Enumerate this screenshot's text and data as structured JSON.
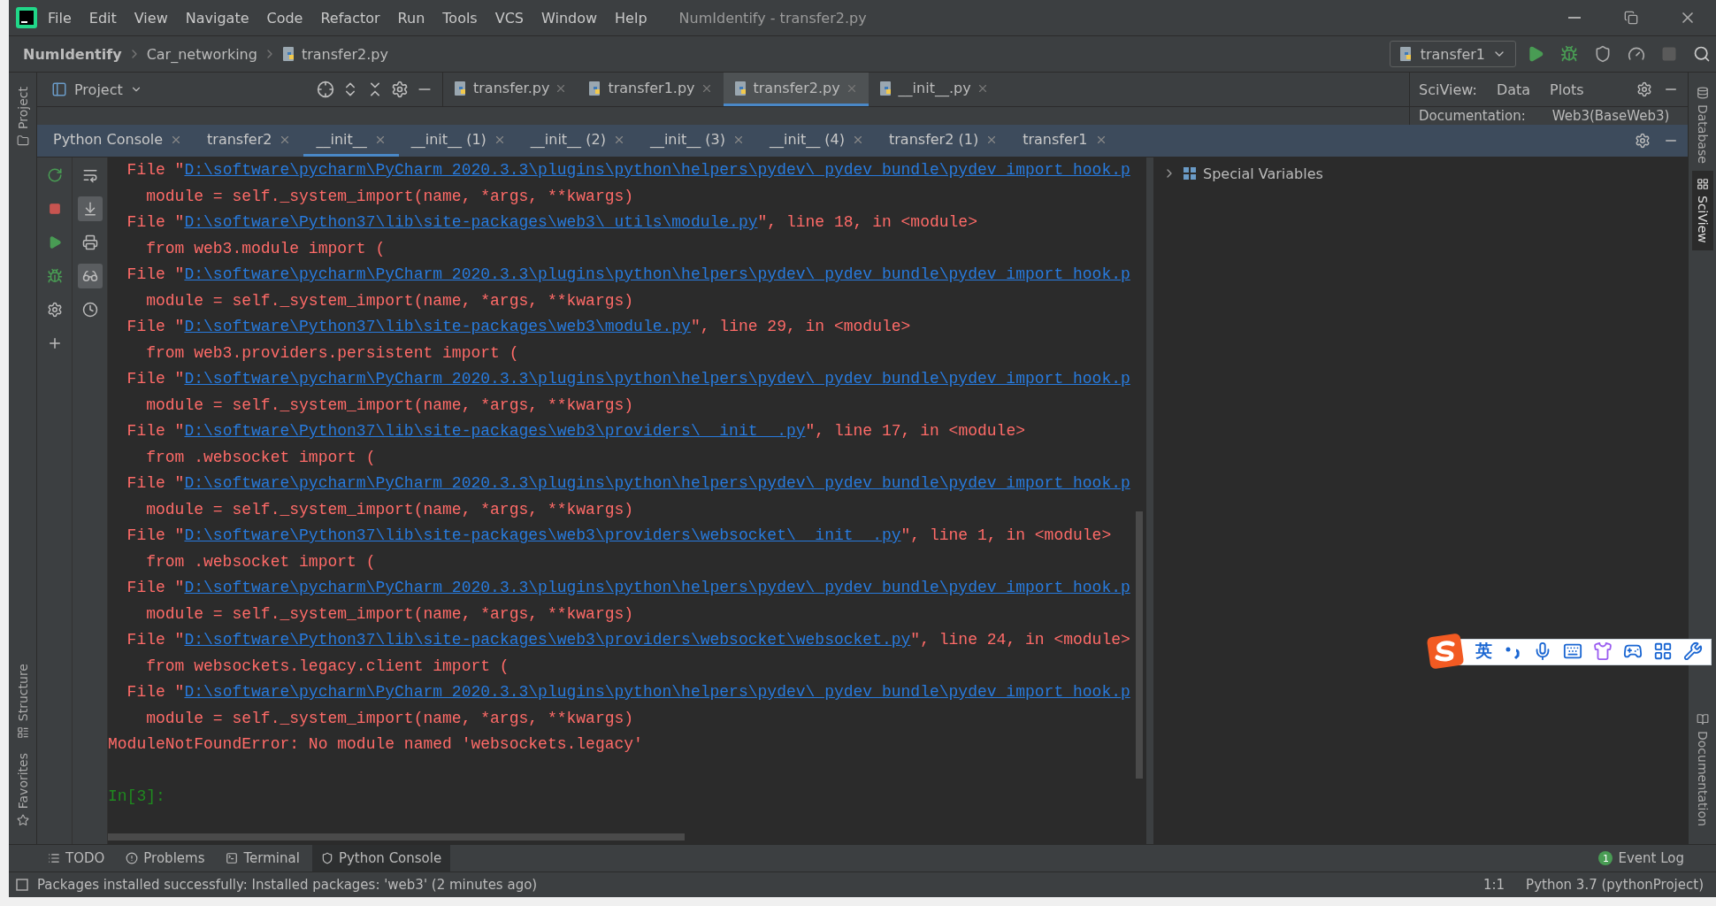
{
  "menu_bar": {
    "items": [
      "File",
      "Edit",
      "View",
      "Navigate",
      "Code",
      "Refactor",
      "Run",
      "Tools",
      "VCS",
      "Window",
      "Help"
    ],
    "title": "NumIdentify - transfer2.py"
  },
  "breadcrumb": [
    "NumIdentify",
    "Car_networking",
    "transfer2.py"
  ],
  "run_config": {
    "label": "transfer1"
  },
  "project_panel": {
    "label": "Project"
  },
  "editor_tabs": [
    {
      "label": "transfer.py",
      "selected": false
    },
    {
      "label": "transfer1.py",
      "selected": false
    },
    {
      "label": "transfer2.py",
      "selected": true
    },
    {
      "label": "__init__.py",
      "selected": false
    }
  ],
  "sciview": {
    "label": "SciView:",
    "tabs": [
      "Data",
      "Plots"
    ],
    "doc_label": "Documentation:",
    "doc_value": "Web3(BaseWeb3)"
  },
  "console_tabs": [
    {
      "label": "Python Console",
      "selected": false
    },
    {
      "label": "transfer2",
      "selected": false
    },
    {
      "label": "__init__",
      "selected": true
    },
    {
      "label": "__init__ (1)",
      "selected": false
    },
    {
      "label": "__init__ (2)",
      "selected": false
    },
    {
      "label": "__init__ (3)",
      "selected": false
    },
    {
      "label": "__init__ (4)",
      "selected": false
    },
    {
      "label": "transfer2 (1)",
      "selected": false
    },
    {
      "label": "transfer1",
      "selected": false
    }
  ],
  "console_tools": [
    {
      "kind": "wrap",
      "on": false
    },
    {
      "kind": "scroll",
      "on": true
    },
    {
      "kind": "print",
      "on": false
    },
    {
      "kind": "variables",
      "on": true
    },
    {
      "kind": "history",
      "on": false
    }
  ],
  "console": {
    "lines": [
      {
        "kind": "file",
        "lead": "  File \"",
        "link": "D:\\software\\pycharm\\PyCharm 2020.3.3\\plugins\\python\\helpers\\pydev\\_pydev_bundle\\pydev_import_hook.p"
      },
      {
        "kind": "code",
        "text": "    module = self._system_import(name, *args, **kwargs)"
      },
      {
        "kind": "file",
        "lead": "  File \"",
        "link": "D:\\software\\Python37\\lib\\site-packages\\web3\\_utils\\module.py",
        "tail": "\", line 18, in <module>"
      },
      {
        "kind": "code",
        "text": "    from web3.module import ("
      },
      {
        "kind": "file",
        "lead": "  File \"",
        "link": "D:\\software\\pycharm\\PyCharm 2020.3.3\\plugins\\python\\helpers\\pydev\\_pydev_bundle\\pydev_import_hook.p"
      },
      {
        "kind": "code",
        "text": "    module = self._system_import(name, *args, **kwargs)"
      },
      {
        "kind": "file",
        "lead": "  File \"",
        "link": "D:\\software\\Python37\\lib\\site-packages\\web3\\module.py",
        "tail": "\", line 29, in <module>"
      },
      {
        "kind": "code",
        "text": "    from web3.providers.persistent import ("
      },
      {
        "kind": "file",
        "lead": "  File \"",
        "link": "D:\\software\\pycharm\\PyCharm 2020.3.3\\plugins\\python\\helpers\\pydev\\_pydev_bundle\\pydev_import_hook.p"
      },
      {
        "kind": "code",
        "text": "    module = self._system_import(name, *args, **kwargs)"
      },
      {
        "kind": "file",
        "lead": "  File \"",
        "link": "D:\\software\\Python37\\lib\\site-packages\\web3\\providers\\__init__.py",
        "tail": "\", line 17, in <module>"
      },
      {
        "kind": "code",
        "text": "    from .websocket import ("
      },
      {
        "kind": "file",
        "lead": "  File \"",
        "link": "D:\\software\\pycharm\\PyCharm 2020.3.3\\plugins\\python\\helpers\\pydev\\_pydev_bundle\\pydev_import_hook.p"
      },
      {
        "kind": "code",
        "text": "    module = self._system_import(name, *args, **kwargs)"
      },
      {
        "kind": "file",
        "lead": "  File \"",
        "link": "D:\\software\\Python37\\lib\\site-packages\\web3\\providers\\websocket\\__init__.py",
        "tail": "\", line 1, in <module>"
      },
      {
        "kind": "code",
        "text": "    from .websocket import ("
      },
      {
        "kind": "file",
        "lead": "  File \"",
        "link": "D:\\software\\pycharm\\PyCharm 2020.3.3\\plugins\\python\\helpers\\pydev\\_pydev_bundle\\pydev_import_hook.p"
      },
      {
        "kind": "code",
        "text": "    module = self._system_import(name, *args, **kwargs)"
      },
      {
        "kind": "file",
        "lead": "  File \"",
        "link": "D:\\software\\Python37\\lib\\site-packages\\web3\\providers\\websocket\\websocket.py",
        "tail": "\", line 24, in <module>"
      },
      {
        "kind": "code",
        "text": "    from websockets.legacy.client import ("
      },
      {
        "kind": "file",
        "lead": "  File \"",
        "link": "D:\\software\\pycharm\\PyCharm 2020.3.3\\plugins\\python\\helpers\\pydev\\_pydev_bundle\\pydev_import_hook.p"
      },
      {
        "kind": "code",
        "text": "    module = self._system_import(name, *args, **kwargs)"
      },
      {
        "kind": "error",
        "text": "ModuleNotFoundError: No module named 'websockets.legacy'"
      },
      {
        "kind": "blank"
      },
      {
        "kind": "prompt",
        "text": "In[3]:"
      }
    ]
  },
  "variables": {
    "items": [
      "Special Variables"
    ]
  },
  "left_stripe": [
    {
      "kind": "project",
      "label": "Project"
    },
    {
      "kind": "structure",
      "label": "Structure"
    },
    {
      "kind": "favorites",
      "label": "Favorites"
    }
  ],
  "right_stripe": [
    {
      "kind": "database",
      "label": "Database",
      "selected": false
    },
    {
      "kind": "sciview",
      "label": "SciView",
      "selected": true
    },
    {
      "kind": "documentation",
      "label": "Documentation",
      "selected": false
    }
  ],
  "bottom_tabs": [
    {
      "kind": "todo",
      "label": "TODO",
      "selected": false
    },
    {
      "kind": "problems",
      "label": "Problems",
      "selected": false
    },
    {
      "kind": "terminal",
      "label": "Terminal",
      "selected": false
    },
    {
      "kind": "console",
      "label": "Python Console",
      "selected": true
    }
  ],
  "event_log": {
    "label": "Event Log",
    "count": "1"
  },
  "status_bar": {
    "message": "Packages installed successfully: Installed packages: 'web3' (2 minutes ago)",
    "position": "1:1",
    "interpreter": "Python 3.7 (pythonProject)"
  },
  "ime_bar": {
    "language": "英"
  }
}
